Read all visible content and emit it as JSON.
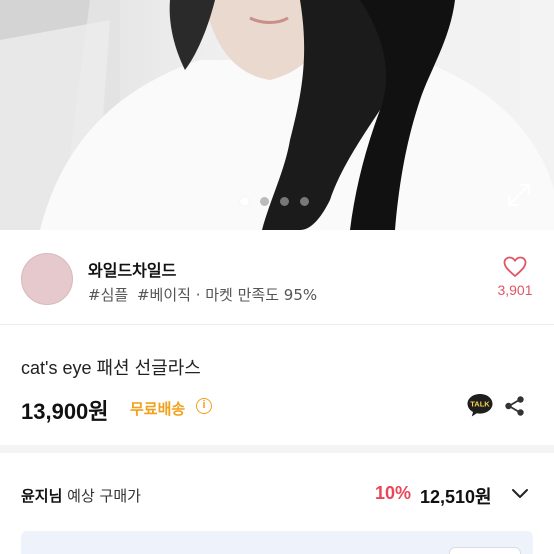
{
  "hero": {
    "slide_count": 4,
    "active_slide": 0,
    "expand_icon": "expand-icon"
  },
  "seller": {
    "name": "와일드차일드",
    "tags": [
      "#심플",
      "#베이직"
    ],
    "separator": " · ",
    "satisfaction": "마켓 만족도 95%",
    "like_icon": "heart-icon",
    "like_count": "3,901"
  },
  "product": {
    "title": "cat's eye 패션 선글라스",
    "price": "13,900원",
    "shipping": "무료배송",
    "info_icon": "i",
    "talk_icon_label": "TALK",
    "share_icon": "share-icon"
  },
  "expected_price": {
    "user": "윤지님",
    "label": " 예상 구매가",
    "discount": "10%",
    "price": "12,510원",
    "toggle_icon": "chevron-down-icon"
  },
  "colors": {
    "like": "#e05565",
    "discount": "#e8475a",
    "shipping": "#f1a11c",
    "talk_bubble": "#1e1e1e",
    "talk_text": "#f7d64a"
  }
}
